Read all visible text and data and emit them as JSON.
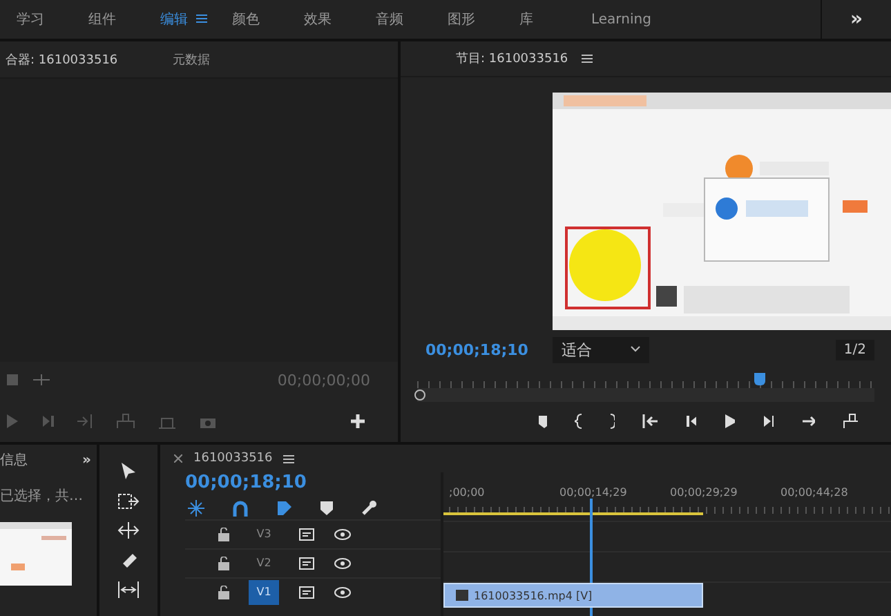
{
  "workspaces": [
    {
      "label": "学习",
      "selected": false
    },
    {
      "label": "组件",
      "selected": false
    },
    {
      "label": "编辑",
      "selected": true
    },
    {
      "label": "颜色",
      "selected": false
    },
    {
      "label": "效果",
      "selected": false
    },
    {
      "label": "音频",
      "selected": false
    },
    {
      "label": "图形",
      "selected": false
    },
    {
      "label": "库",
      "selected": false
    },
    {
      "label": "Learning",
      "selected": false
    }
  ],
  "workspace_overflow": "»",
  "source_panel": {
    "tabs": [
      {
        "label": "合器: 1610033516",
        "selected": true
      },
      {
        "label": "元数据",
        "selected": false
      }
    ],
    "timecode": "00;00;00;00"
  },
  "program_panel": {
    "title": "节目: 1610033516",
    "timecode": "00;00;18;10",
    "zoom": "适合",
    "resolution": "1/2",
    "playhead": {
      "level": 0.75
    }
  },
  "info_panel": {
    "title": "信息",
    "overflow": "»",
    "text": "已选择，共…"
  },
  "timeline": {
    "title": "1610033516",
    "timecode": "00;00;18;10",
    "ruler": [
      ";00;00",
      "00;00;14;29",
      "00;00;29;29",
      "00;00;44;28"
    ],
    "playhead": {
      "level": 0.33
    },
    "work_area": {
      "level": 0.58
    },
    "tracks": [
      {
        "name": "V3",
        "selected": false
      },
      {
        "name": "V2",
        "selected": false
      },
      {
        "name": "V1",
        "selected": true,
        "clip": "1610033516.mp4 [V]"
      }
    ]
  }
}
